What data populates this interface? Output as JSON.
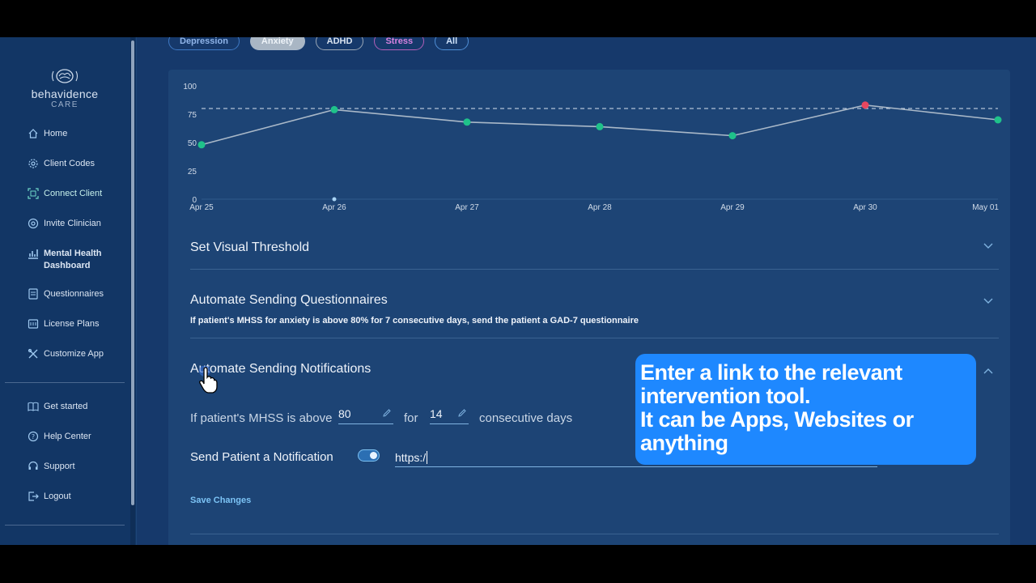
{
  "brand": {
    "name": "behavidence",
    "sub": "CARE"
  },
  "filters": [
    {
      "label": "Depression",
      "border": "#3e79c4",
      "color": "#8fb4e8",
      "bg": "transparent"
    },
    {
      "label": "Anxiety",
      "border": "#a9b8c9",
      "color": "#eef3f8",
      "bg": "#a9b6c4"
    },
    {
      "label": "ADHD",
      "border": "#9aa7b6",
      "color": "#d8e2ee",
      "bg": "transparent"
    },
    {
      "label": "Stress",
      "border": "#b25fb8",
      "color": "#d682df",
      "bg": "transparent"
    },
    {
      "label": "All",
      "border": "#4f8fd6",
      "color": "#cfe3fb",
      "bg": "transparent"
    }
  ],
  "sidebar": {
    "items": [
      {
        "label": "Home",
        "icon": "home-icon"
      },
      {
        "label": "Client Codes",
        "icon": "gear-icon"
      },
      {
        "label": "Connect Client",
        "icon": "qr-scan-icon"
      },
      {
        "label": "Invite Clinician",
        "icon": "at-sign-icon"
      },
      {
        "label": "Mental Health Dashboard",
        "icon": "chart-icon"
      },
      {
        "label": "Questionnaires",
        "icon": "questionnaire-icon"
      },
      {
        "label": "License Plans",
        "icon": "license-icon"
      },
      {
        "label": "Customize App",
        "icon": "tools-icon"
      }
    ],
    "bottom_items": [
      {
        "label": "Get started",
        "icon": "book-icon"
      },
      {
        "label": "Help Center",
        "icon": "help-icon"
      },
      {
        "label": "Support",
        "icon": "support-icon"
      },
      {
        "label": "Logout",
        "icon": "logout-icon"
      }
    ]
  },
  "chart_data": {
    "type": "line",
    "categories": [
      "Apr 25",
      "Apr 26",
      "Apr 27",
      "Apr 28",
      "Apr 29",
      "Apr 30",
      "May 01"
    ],
    "series": [
      {
        "values": [
          48,
          79,
          68,
          64,
          56,
          83,
          70
        ],
        "color": "#a9b8c8"
      }
    ],
    "point_colors": [
      "#1fc28a",
      "#1fc28a",
      "#1fc28a",
      "#1fc28a",
      "#1fc28a",
      "#e8475f",
      "#1fc28a"
    ],
    "threshold": 80,
    "y_ticks": [
      "0",
      "25",
      "50",
      "75",
      "100"
    ],
    "ylim": [
      0,
      100
    ],
    "grid": false
  },
  "accordion": {
    "visual_threshold": {
      "title": "Set Visual Threshold"
    },
    "questionnaires": {
      "title": "Automate Sending Questionnaires",
      "summary": "If patient's MHSS for anxiety is above 80% for 7 consecutive days, send the patient a GAD-7 questionnaire"
    },
    "notifications": {
      "title": "Automate Sending Notifications",
      "rule_prefix": "If patient's MHSS is above",
      "threshold_value": "80",
      "for_label": "for",
      "days_value": "14",
      "days_suffix": "consecutive days",
      "send_label": "Send Patient a Notification",
      "toggle_on": true,
      "url_value": "https:/",
      "save_label": "Save Changes"
    }
  },
  "callout": {
    "lines": [
      "Enter a link to the relevant",
      "intervention tool.",
      "It can be Apps, Websites or",
      "anything"
    ]
  }
}
